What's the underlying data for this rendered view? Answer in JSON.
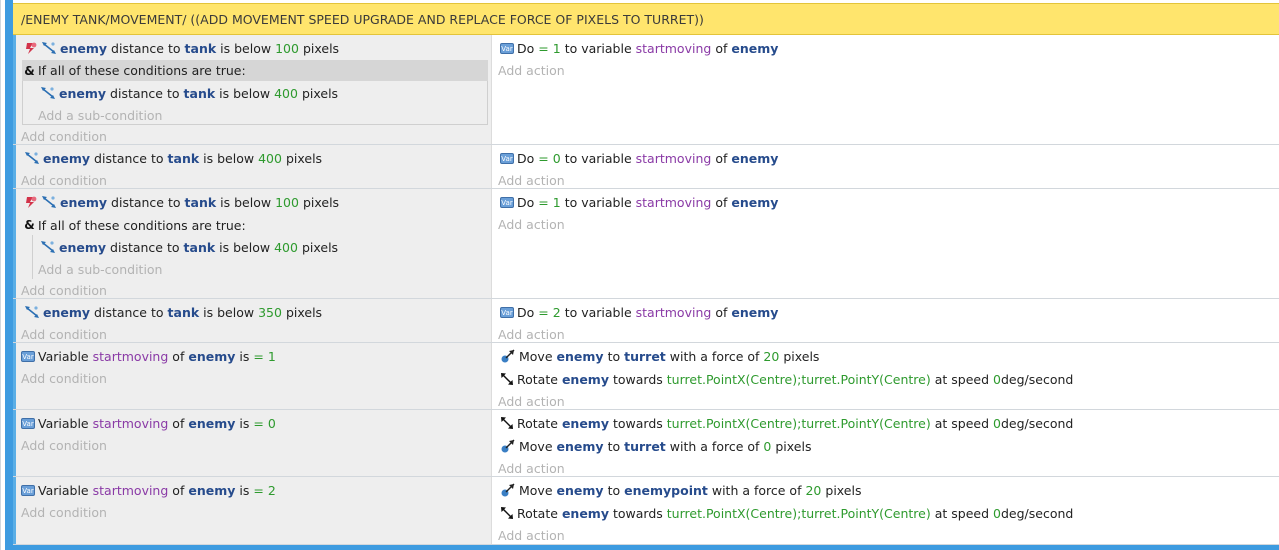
{
  "group": {
    "title": "/ENEMY TANK/MOVEMENT/ ((ADD MOVEMENT SPEED UPGRADE AND REPLACE FORCE OF PIXELS TO TURRET))"
  },
  "labels": {
    "add_condition": "Add condition",
    "add_action": "Add action",
    "add_sub_condition": "Add a sub-condition",
    "if_all": "If all of these conditions are true:",
    "var_icon_text": "Var"
  },
  "events": [
    {
      "conds": [
        {
          "obj": "enemy",
          "t1": "distance to",
          "obj2": "tank",
          "t2": "is below",
          "num": "100",
          "t3": "pixels"
        }
      ],
      "sub": [
        {
          "obj": "enemy",
          "t1": "distance to",
          "obj2": "tank",
          "t2": "is below",
          "num": "400",
          "t3": "pixels"
        }
      ],
      "acts": [
        {
          "t0": "Do",
          "t1": "= 1",
          "t2": "to variable",
          "var": "startmoving",
          "t3": "of",
          "obj": "enemy"
        }
      ]
    },
    {
      "conds": [
        {
          "obj": "enemy",
          "t1": "distance to",
          "obj2": "tank",
          "t2": "is below",
          "num": "400",
          "t3": "pixels"
        }
      ],
      "acts": [
        {
          "t0": "Do",
          "t1": "= 0",
          "t2": "to variable",
          "var": "startmoving",
          "t3": "of",
          "obj": "enemy"
        }
      ]
    },
    {
      "conds": [
        {
          "obj": "enemy",
          "t1": "distance to",
          "obj2": "tank",
          "t2": "is below",
          "num": "100",
          "t3": "pixels"
        }
      ],
      "sub": [
        {
          "obj": "enemy",
          "t1": "distance to",
          "obj2": "tank",
          "t2": "is below",
          "num": "400",
          "t3": "pixels"
        }
      ],
      "acts": [
        {
          "t0": "Do",
          "t1": "= 1",
          "t2": "to variable",
          "var": "startmoving",
          "t3": "of",
          "obj": "enemy"
        }
      ]
    },
    {
      "conds": [
        {
          "obj": "enemy",
          "t1": "distance to",
          "obj2": "tank",
          "t2": "is below",
          "num": "350",
          "t3": "pixels"
        }
      ],
      "acts": [
        {
          "t0": "Do",
          "t1": "= 2",
          "t2": "to variable",
          "var": "startmoving",
          "t3": "of",
          "obj": "enemy"
        }
      ]
    },
    {
      "conds": [
        {
          "t0": "Variable",
          "var": "startmoving",
          "t1": "of",
          "obj": "enemy",
          "t2": "is",
          "num": "= 1"
        }
      ],
      "acts": [
        {
          "t0": "Move",
          "obj": "enemy",
          "t1": "to",
          "obj2": "turret",
          "t2": "with a force of",
          "num": "20",
          "t3": "pixels"
        },
        {
          "t0": "Rotate",
          "obj": "enemy",
          "t1": "towards",
          "expr": "turret.PointX(Centre);turret.PointY(Centre)",
          "t2": "at speed",
          "num": "0",
          "t3": "deg/second"
        }
      ]
    },
    {
      "conds": [
        {
          "t0": "Variable",
          "var": "startmoving",
          "t1": "of",
          "obj": "enemy",
          "t2": "is",
          "num": "= 0"
        }
      ],
      "acts": [
        {
          "t0": "Rotate",
          "obj": "enemy",
          "t1": "towards",
          "expr": "turret.PointX(Centre);turret.PointY(Centre)",
          "t2": "at speed",
          "num": "0",
          "t3": "deg/second"
        },
        {
          "t0": "Move",
          "obj": "enemy",
          "t1": "to",
          "obj2": "turret",
          "t2": "with a force of",
          "num": "0",
          "t3": "pixels"
        }
      ]
    },
    {
      "conds": [
        {
          "t0": "Variable",
          "var": "startmoving",
          "t1": "of",
          "obj": "enemy",
          "t2": "is",
          "num": "= 2"
        }
      ],
      "acts": [
        {
          "t0": "Move",
          "obj": "enemy",
          "t1": "to",
          "obj2": "enemypoint",
          "t2": "with a force of",
          "num": "20",
          "t3": "pixels"
        },
        {
          "t0": "Rotate",
          "obj": "enemy",
          "t1": "towards",
          "expr": "turret.PointX(Centre);turret.PointY(Centre)",
          "t2": "at speed",
          "num": "0",
          "t3": "deg/second"
        }
      ]
    }
  ]
}
